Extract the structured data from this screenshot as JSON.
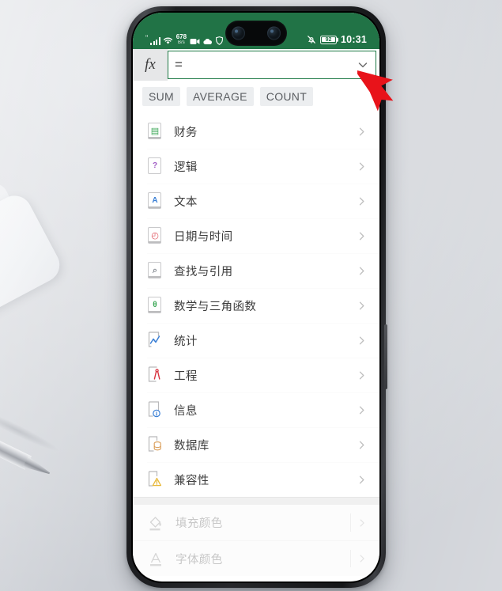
{
  "statusbar": {
    "signal_icon": "signal-bars-icon",
    "quote_mark": "\"",
    "wifi_icon": "wifi-icon",
    "net_speed_value": "678",
    "net_speed_unit": "B/s",
    "video_icon": "video-camera-icon",
    "cloud_icon": "cloud-icon",
    "shield_icon": "shield-icon",
    "mute_icon": "bell-muted-icon",
    "battery_level": "92",
    "time": "10:31",
    "bg_color": "#217346"
  },
  "formula_bar": {
    "fx_label": "fx",
    "equals": "=",
    "value": "",
    "placeholder": "",
    "expand_icon": "chevron-down-icon",
    "border_color": "#1f7a46"
  },
  "quick_functions": [
    {
      "label": "SUM"
    },
    {
      "label": "AVERAGE"
    },
    {
      "label": "COUNT"
    }
  ],
  "categories": [
    {
      "label": "财务",
      "icon": "finance-icon",
      "glyph": "▤",
      "color": "#3aa655"
    },
    {
      "label": "逻辑",
      "icon": "logic-icon",
      "glyph": "?",
      "color": "#a05bc4"
    },
    {
      "label": "文本",
      "icon": "text-icon",
      "glyph": "A",
      "color": "#3a7fd5"
    },
    {
      "label": "日期与时间",
      "icon": "date-time-icon",
      "glyph": "◴",
      "color": "#e0555f"
    },
    {
      "label": "查找与引用",
      "icon": "lookup-reference-icon",
      "glyph": "⌕",
      "color": "#8a8f96"
    },
    {
      "label": "数学与三角函数",
      "icon": "math-trig-icon",
      "glyph": "θ",
      "color": "#3aa655"
    },
    {
      "label": "统计",
      "icon": "statistics-icon",
      "glyph": "∿",
      "color": "#3a7fd5"
    },
    {
      "label": "工程",
      "icon": "engineering-icon",
      "glyph": "⋀",
      "color": "#d8333f"
    },
    {
      "label": "信息",
      "icon": "information-icon",
      "glyph": "i",
      "color": "#3a7fd5"
    },
    {
      "label": "数据库",
      "icon": "database-icon",
      "glyph": "⛁",
      "color": "#d99a52"
    },
    {
      "label": "兼容性",
      "icon": "compatibility-icon",
      "glyph": "⚠",
      "color": "#e8b93a"
    }
  ],
  "chevron_icon": "chevron-right-icon",
  "disabled_items": [
    {
      "label": "填充颜色",
      "icon": "paint-bucket-icon"
    },
    {
      "label": "字体颜色",
      "icon": "font-color-icon"
    }
  ],
  "annotation": {
    "arrow_icon": "red-pointer-arrow",
    "color": "#e8131a",
    "points_at": "formula-expand-chevron"
  }
}
